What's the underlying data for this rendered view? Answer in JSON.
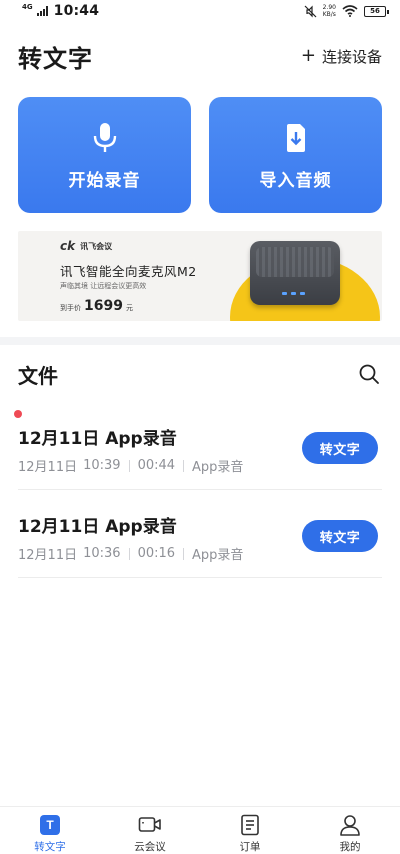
{
  "status_bar": {
    "network": "4G",
    "time": "10:44",
    "speed_value": "2.90",
    "speed_unit": "KB/s",
    "battery": "56"
  },
  "header": {
    "title": "转文字",
    "connect_label": "连接设备"
  },
  "actions": [
    {
      "label": "开始录音",
      "icon": "microphone-icon"
    },
    {
      "label": "导入音频",
      "icon": "import-file-icon"
    }
  ],
  "banner": {
    "brand": "讯飞会议",
    "product": "讯飞智能全向麦克风M2",
    "tagline": "声临其境 让远程会议更高效",
    "price_label": "到手价",
    "price": "1699",
    "price_unit": "元"
  },
  "files": {
    "title": "文件",
    "items": [
      {
        "title": "12月11日 App录音",
        "date": "12月11日",
        "time": "10:39",
        "duration": "00:44",
        "source": "App录音",
        "action": "转文字",
        "unread": true
      },
      {
        "title": "12月11日 App录音",
        "date": "12月11日",
        "time": "10:36",
        "duration": "00:16",
        "source": "App录音",
        "action": "转文字",
        "unread": false
      }
    ]
  },
  "bottom_nav": {
    "items": [
      {
        "label": "转文字",
        "icon": "transcribe-icon",
        "active": true
      },
      {
        "label": "云会议",
        "icon": "video-icon",
        "active": false
      },
      {
        "label": "订单",
        "icon": "order-icon",
        "active": false
      },
      {
        "label": "我的",
        "icon": "profile-icon",
        "active": false
      }
    ]
  },
  "colors": {
    "accent": "#2f6fe8",
    "card": "#4a88f3",
    "unread": "#ef4a55",
    "banner_yellow": "#f5c518"
  }
}
